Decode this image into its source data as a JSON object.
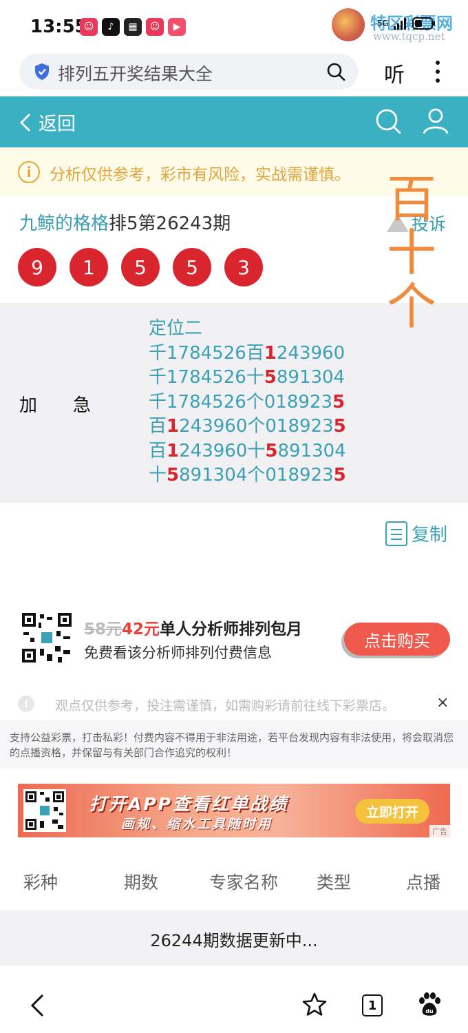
{
  "status_bar": {
    "time": "13:55",
    "network": "5G",
    "watermark_text": "特区彩票网",
    "watermark_url": "www.tqcp.net"
  },
  "search": {
    "query": "排列五开奖结果大全",
    "listen_label": "听"
  },
  "header": {
    "back_label": "返回"
  },
  "notice": {
    "icon": "i",
    "text": "分析仅供参考，彩市有风险，实战需谨慎。"
  },
  "expert": {
    "name": "九鲸的格格",
    "issue": "排5第26243期",
    "complaint_label": "投诉",
    "balls": [
      "9",
      "1",
      "5",
      "5",
      "3"
    ]
  },
  "overlay": {
    "lines": [
      "百",
      "十",
      "个"
    ]
  },
  "analysis": {
    "label": "加急",
    "lines": [
      [
        {
          "t": "定位二",
          "h": false
        }
      ],
      [
        {
          "t": "千1784526百",
          "h": false
        },
        {
          "t": "1",
          "h": true
        },
        {
          "t": "243960",
          "h": false
        }
      ],
      [
        {
          "t": "千1784526十",
          "h": false
        },
        {
          "t": "5",
          "h": true
        },
        {
          "t": "891304",
          "h": false
        }
      ],
      [
        {
          "t": "千1784526个018923",
          "h": false
        },
        {
          "t": "5",
          "h": true
        }
      ],
      [
        {
          "t": "百",
          "h": false
        },
        {
          "t": "1",
          "h": true
        },
        {
          "t": "243960个018923",
          "h": false
        },
        {
          "t": "5",
          "h": true
        }
      ],
      [
        {
          "t": "百",
          "h": false
        },
        {
          "t": "1",
          "h": true
        },
        {
          "t": "243960十",
          "h": false
        },
        {
          "t": "5",
          "h": true
        },
        {
          "t": "891304",
          "h": false
        }
      ],
      [
        {
          "t": "十",
          "h": false
        },
        {
          "t": "5",
          "h": true
        },
        {
          "t": "891304个018923",
          "h": false
        },
        {
          "t": "5",
          "h": true
        }
      ]
    ],
    "copy_label": "复制"
  },
  "promo": {
    "old_price": "58元",
    "new_price": "42元",
    "title": "单人分析师排列包月",
    "subtitle": "免费看该分析师排列付费信息",
    "buy_label": "点击购买"
  },
  "disclaimer": {
    "icon": "!",
    "text": "观点仅供参考，投注需谨慎，如需购彩请前往线下彩票店。",
    "close": "×"
  },
  "legal": {
    "text": "支持公益彩票，打击私彩！付费内容不得用于非法用途，若平台发现内容有非法使用，将会取消您的点播资格，并保留与有关部门合作追究的权利！"
  },
  "banner": {
    "title": "打开APP查看红单战绩",
    "subtitle": "画规、缩水工具随时用",
    "open_label": "立即打开",
    "ad_label": "广告"
  },
  "table": {
    "headers": [
      "彩种",
      "期数",
      "专家名称",
      "类型",
      "点播"
    ],
    "row_text": "26244期数据更新中..."
  },
  "bottom_nav": {
    "tab_count": "1"
  },
  "colors": {
    "teal": "#3bb0c3",
    "ball_red": "#d9262e",
    "notice_orange": "#e2a53b",
    "overlay_orange": "#f08a3c"
  }
}
